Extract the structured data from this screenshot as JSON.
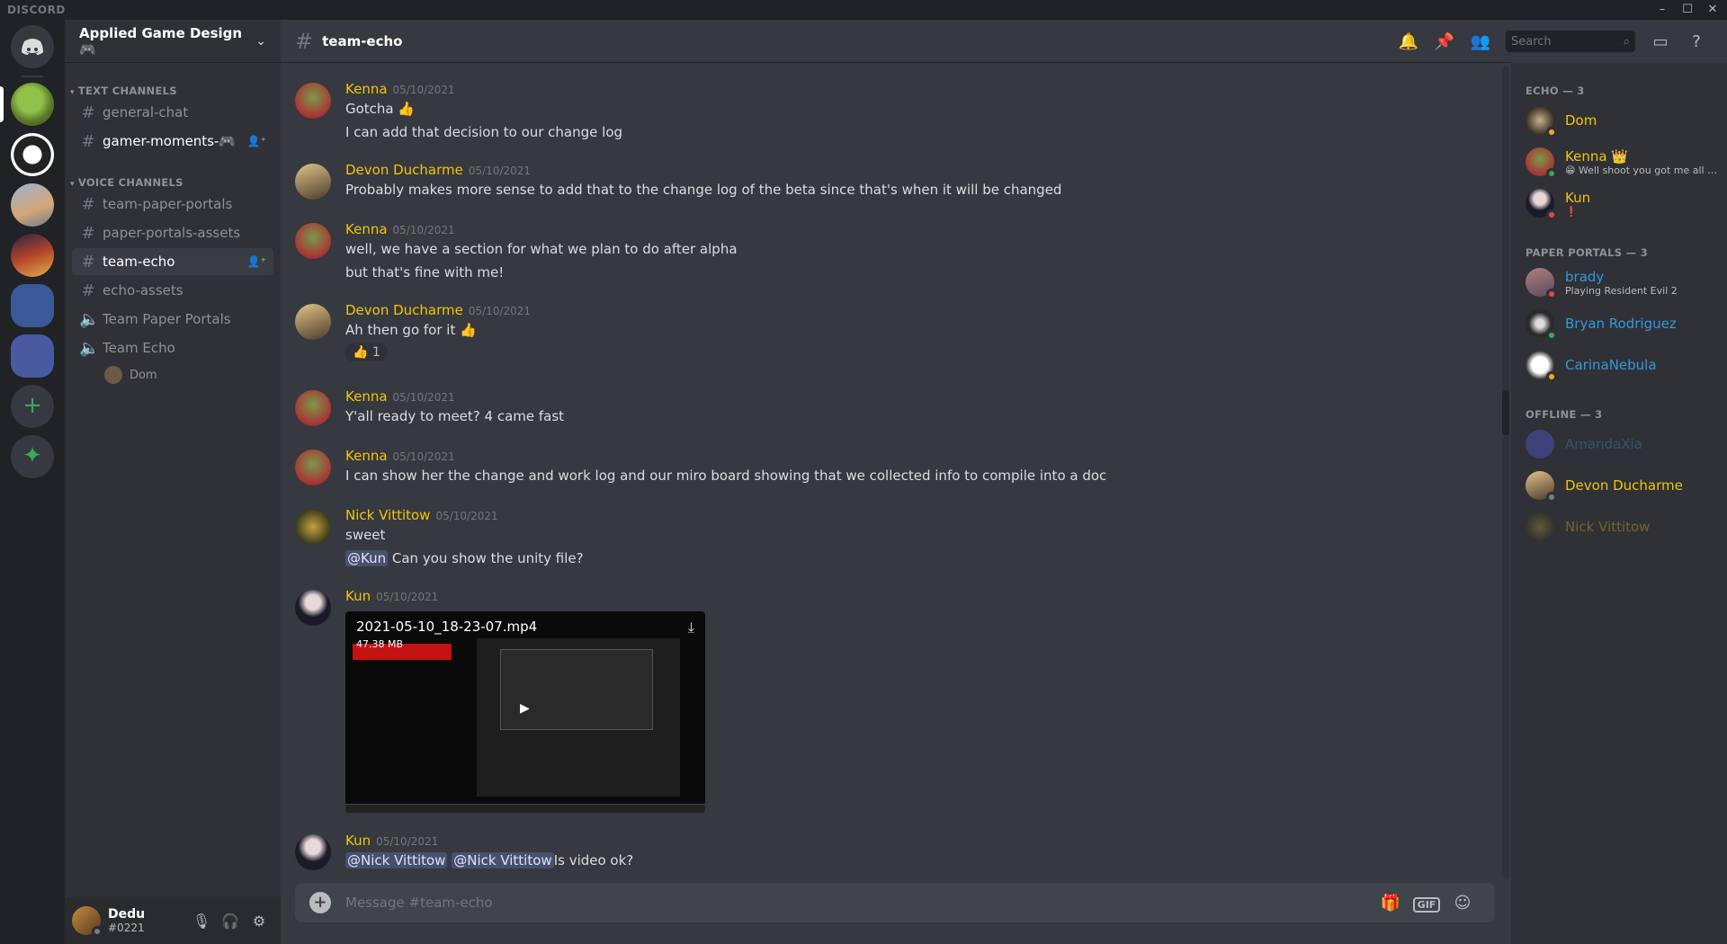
{
  "window": {
    "brand": "DISCORD",
    "minimize": "–",
    "maximize": "☐",
    "close": "✕"
  },
  "guild": {
    "name": "Applied Game Design 🎮"
  },
  "categories": {
    "text": "TEXT CHANNELS",
    "voice": "VOICE CHANNELS"
  },
  "text_channels": [
    {
      "name": "general-chat"
    },
    {
      "name": "gamer-moments-🎮"
    }
  ],
  "voice_section_channels": [
    {
      "name": "team-paper-portals"
    },
    {
      "name": "paper-portals-assets"
    },
    {
      "name": "team-echo"
    },
    {
      "name": "echo-assets"
    },
    {
      "name": "Team Paper Portals"
    },
    {
      "name": "Team Echo"
    }
  ],
  "voice_users": [
    {
      "name": "Dom"
    }
  ],
  "current_user": {
    "name": "Dedu",
    "discriminator": "#0221"
  },
  "channel": {
    "name": "team-echo",
    "placeholder": "Message #team-echo"
  },
  "search": {
    "placeholder": "Search"
  },
  "messages": [
    {
      "author": "Kenna",
      "time": "05/10/2021",
      "lines": [
        "Gotcha 👍",
        "I can add that decision to our change log"
      ]
    },
    {
      "author": "Devon Ducharme",
      "time": "05/10/2021",
      "lines": [
        "Probably makes more sense to add that to the change log of the beta since that's when it will be changed"
      ]
    },
    {
      "author": "Kenna",
      "time": "05/10/2021",
      "lines": [
        "well, we have a section for what we plan to do after alpha",
        "but that's fine with me!"
      ]
    },
    {
      "author": "Devon Ducharme",
      "time": "05/10/2021",
      "lines": [
        "Ah then go for it 👍"
      ],
      "reaction": {
        "emoji": "👍",
        "count": "1"
      }
    },
    {
      "author": "Kenna",
      "time": "05/10/2021",
      "lines": [
        "Y'all ready to meet? 4 came fast"
      ]
    },
    {
      "author": "Kenna",
      "time": "05/10/2021",
      "lines": [
        "I can show her the change and work log and our miro board showing that we collected info to compile into a doc"
      ]
    },
    {
      "author": "Nick Vittitow",
      "time": "05/10/2021",
      "lines": [
        "sweet"
      ],
      "mention": "@Kun",
      "after_mention": " Can you show the unity file?"
    },
    {
      "author": "Kun",
      "time": "05/10/2021",
      "attachment": {
        "filename": "2021-05-10_18-23-07.mp4",
        "size": "47.38 MB"
      }
    },
    {
      "author": "Kun",
      "time": "05/10/2021",
      "mention1": "@Nick Vittitow",
      "mention2": "@Nick Vittitow",
      "after_mention": "Is video ok?"
    }
  ],
  "members": {
    "echo_header": "ECHO — 3",
    "echo": [
      {
        "name": "Dom"
      },
      {
        "name": "Kenna 👑",
        "status": "😁 Well shoot you got me all y..."
      },
      {
        "name": "Kun",
        "status": "❗"
      }
    ],
    "pp_header": "PAPER PORTALS — 3",
    "pp": [
      {
        "name": "brady",
        "status": "Playing Resident Evil 2"
      },
      {
        "name": "Bryan Rodriguez"
      },
      {
        "name": "CarinaNebula"
      }
    ],
    "offline_header": "OFFLINE — 3",
    "offline": [
      {
        "name": "AmandaXia"
      },
      {
        "name": "Devon Ducharme"
      },
      {
        "name": "Nick Vittitow"
      }
    ]
  },
  "colors": {
    "accent": "#5865f2",
    "gold_role": "#f1c40f",
    "blue_role": "#3498db",
    "online": "#3ba55d",
    "idle": "#faa81a",
    "dnd": "#ed4245",
    "offline": "#747f8d"
  }
}
